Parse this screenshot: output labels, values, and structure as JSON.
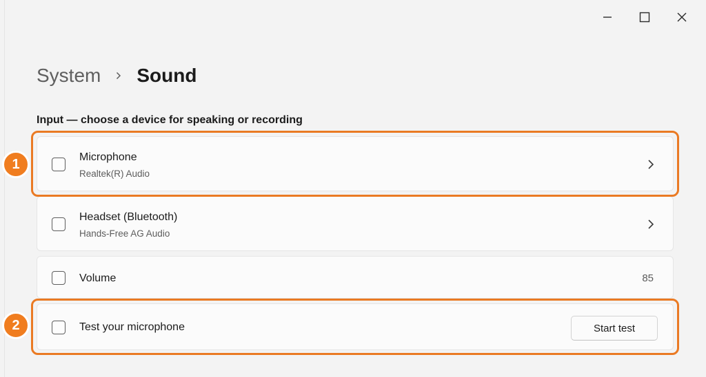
{
  "window": {
    "controls": [
      {
        "name": "minimize",
        "icon": "minimize-icon"
      },
      {
        "name": "maximize",
        "icon": "maximize-icon"
      },
      {
        "name": "close",
        "icon": "close-icon"
      }
    ]
  },
  "breadcrumb": {
    "parent": "System",
    "separator_icon": "chevron-right-icon",
    "current": "Sound"
  },
  "input_section": {
    "title": "Input — choose a device for speaking or recording",
    "items": [
      {
        "title": "Microphone",
        "subtitle": "Realtek(R) Audio",
        "icon": "chevron-right-icon"
      },
      {
        "title": "Headset (Bluetooth)",
        "subtitle": "Hands-Free AG Audio",
        "icon": "chevron-right-icon"
      },
      {
        "title": "Volume",
        "value": "85"
      },
      {
        "title": "Test your microphone",
        "button_label": "Start test"
      }
    ]
  },
  "annotations": {
    "badges": [
      "1",
      "2"
    ],
    "color": "#ea7a23"
  }
}
